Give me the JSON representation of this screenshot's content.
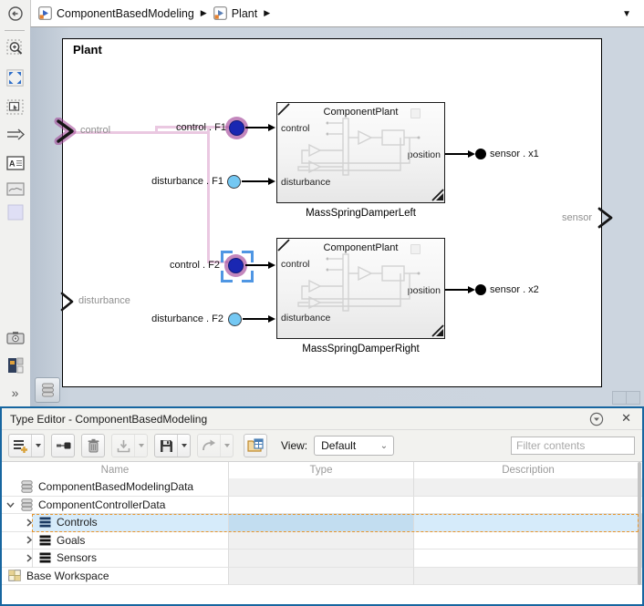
{
  "colors": {
    "panel_accent_blue": "#1766a0",
    "selection_orange_dash": "#e8962e",
    "selection_blue_bg": "#d6ebfa",
    "selection_blue_type_cell": "#c2ddf0",
    "wire_highlight_pink": "#eac8e1",
    "port_highlight_magenta": "#9e3e94",
    "signal_dark_blue": "#1a27b2",
    "signal_light_blue": "#74c8f3",
    "canvas_margin": "#ccd5df"
  },
  "breadcrumb": {
    "items": [
      {
        "label": "ComponentBasedModeling",
        "icon": "model-badge-icon"
      },
      {
        "label": "Plant",
        "icon": "subsystem-badge-icon"
      }
    ],
    "separator": "▶",
    "dropdown_caret": "▼"
  },
  "palette": {
    "tools": [
      "back-button",
      "zoom-region",
      "fit-to-view",
      "select-region",
      "auto-route",
      "annotation",
      "image",
      "viewer-area",
      "screenshot",
      "block-palette",
      "expand-toolbar"
    ]
  },
  "canvas": {
    "title": "Plant",
    "boundary_inputs": [
      {
        "label": "control",
        "highlighted": true
      },
      {
        "label": "disturbance",
        "highlighted": false
      }
    ],
    "boundary_outputs": [
      {
        "label": "sensor"
      }
    ],
    "signals": [
      {
        "label": "control . F1",
        "marker": "dark-blue-highlighted"
      },
      {
        "label": "disturbance . F1",
        "marker": "light-blue"
      },
      {
        "label": "sensor . x1",
        "marker": "black"
      },
      {
        "label": "control . F2",
        "marker": "dark-blue-highlighted-selected"
      },
      {
        "label": "disturbance . F2",
        "marker": "light-blue"
      },
      {
        "label": "sensor . x2",
        "marker": "black"
      }
    ],
    "blocks": [
      {
        "caption": "MassSpringDamperLeft",
        "title": "ComponentPlant",
        "inputs": [
          "control",
          "disturbance"
        ],
        "outputs": [
          "position"
        ]
      },
      {
        "caption": "MassSpringDamperRight",
        "title": "ComponentPlant",
        "inputs": [
          "control",
          "disturbance"
        ],
        "outputs": [
          "position"
        ]
      }
    ],
    "corner_badge": "data-dictionary-icon"
  },
  "type_editor": {
    "title": "Type Editor - ComponentBasedModeling",
    "titlebar_icons": [
      "collapse-panel-icon",
      "close-icon"
    ],
    "close_glyph": "✕",
    "toolbar": {
      "buttons": [
        "add-entry",
        "add-element",
        "delete",
        "import",
        "save",
        "forward",
        "open-table"
      ],
      "view_label": "View:",
      "view_value": "Default",
      "filter_placeholder": "Filter contents"
    },
    "table": {
      "columns": [
        "Name",
        "Type",
        "Description"
      ],
      "rows": [
        {
          "name": "ComponentBasedModelingData",
          "icon": "data-dictionary-icon",
          "level": 0,
          "expander": "none",
          "selected": false,
          "type": "",
          "description": ""
        },
        {
          "name": "ComponentControllerData",
          "icon": "data-dictionary-icon",
          "level": 0,
          "expander": "expanded",
          "selected": false,
          "type": "",
          "description": ""
        },
        {
          "name": "Controls",
          "icon": "bus-icon",
          "level": 1,
          "expander": "collapsed",
          "selected": true,
          "type": "",
          "description": ""
        },
        {
          "name": "Goals",
          "icon": "bus-icon",
          "level": 1,
          "expander": "collapsed",
          "selected": false,
          "type": "",
          "description": ""
        },
        {
          "name": "Sensors",
          "icon": "bus-icon",
          "level": 1,
          "expander": "collapsed",
          "selected": false,
          "type": "",
          "description": ""
        },
        {
          "name": "Base Workspace",
          "icon": "workspace-icon",
          "level": 0,
          "expander": "none",
          "selected": false,
          "type": "",
          "description": ""
        }
      ]
    }
  }
}
